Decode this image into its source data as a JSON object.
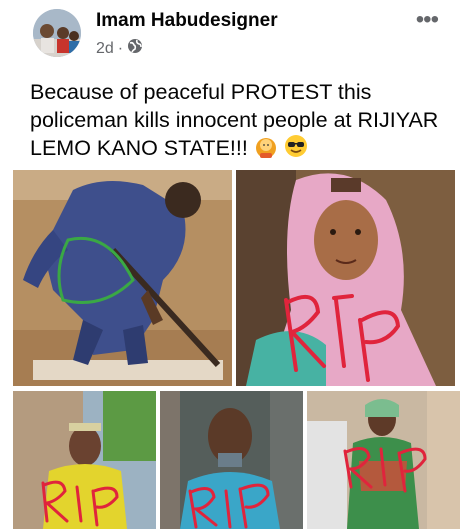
{
  "post": {
    "author_name": "Imam Habudesigner",
    "time_ago": "2d",
    "dot": "·",
    "audience_icon": "globe-icon",
    "more_glyph": "•••",
    "text": "Because of peaceful PROTEST this policeman kills innocent people at RIJIYAR LEMO  KANO STATE!!!",
    "emojis": [
      "woman-with-headscarf-emoji",
      "smiling-face-with-sunglasses-emoji"
    ]
  },
  "photos": [
    {
      "id": "photo-policeman",
      "overlay_text": ""
    },
    {
      "id": "photo-girl-pink-hijab",
      "overlay_text": "RIP"
    },
    {
      "id": "photo-man-yellow-shirt",
      "overlay_text": "RIP"
    },
    {
      "id": "photo-boy-blue-shirt",
      "overlay_text": "RIP"
    },
    {
      "id": "photo-woman-green-dress",
      "overlay_text": "RIP"
    }
  ],
  "colors": {
    "author": "#050505",
    "meta": "#65676b",
    "rip_overlay": "#e0243c"
  }
}
